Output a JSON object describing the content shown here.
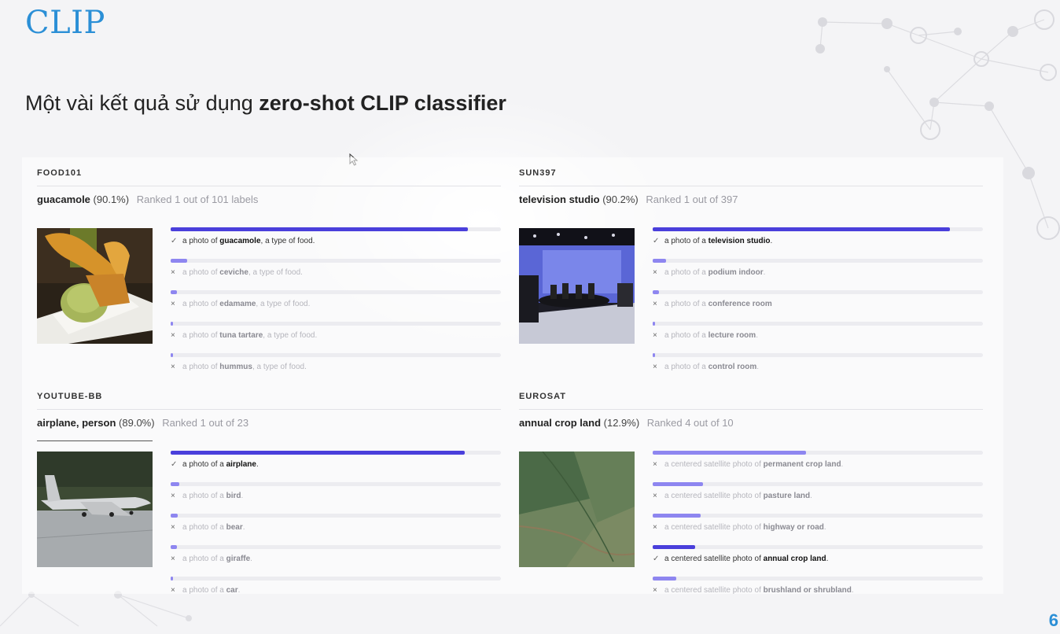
{
  "slide": {
    "title": "CLIP",
    "subtitle_prefix": "Một vài kết quả sử dụng ",
    "subtitle_bold": "zero-shot CLIP classifier",
    "page_number": "6"
  },
  "colors": {
    "accent": "#2b8fd6",
    "bar_correct": "#4a3fdb",
    "bar_other": "#8e86f0"
  },
  "cards": [
    {
      "dataset": "FOOD101",
      "label": "guacamole",
      "pct": "(90.1%)",
      "rank": "Ranked 1 out of 101 labels",
      "image": "guacamole-photo",
      "preds": [
        {
          "pre": "a photo of ",
          "key": "guacamole",
          "post": ", a type of food.",
          "value": 0.9,
          "correct": true
        },
        {
          "pre": "a photo of ",
          "key": "ceviche",
          "post": ", a type of food.",
          "value": 0.05,
          "correct": false
        },
        {
          "pre": "a photo of ",
          "key": "edamame",
          "post": ", a type of food.",
          "value": 0.02,
          "correct": false
        },
        {
          "pre": "a photo of ",
          "key": "tuna tartare",
          "post": ", a type of food.",
          "value": 0.008,
          "correct": false
        },
        {
          "pre": "a photo of ",
          "key": "hummus",
          "post": ", a type of food.",
          "value": 0.004,
          "correct": false
        }
      ]
    },
    {
      "dataset": "SUN397",
      "label": "television studio",
      "pct": "(90.2%)",
      "rank": "Ranked 1 out of 397",
      "image": "television-studio-photo",
      "preds": [
        {
          "pre": "a photo of a ",
          "key": "television studio",
          "post": ".",
          "value": 0.9,
          "correct": true
        },
        {
          "pre": "a photo of a ",
          "key": "podium indoor",
          "post": ".",
          "value": 0.04,
          "correct": false
        },
        {
          "pre": "a photo of a ",
          "key": "conference room",
          "post": "",
          "value": 0.02,
          "correct": false
        },
        {
          "pre": "a photo of a ",
          "key": "lecture room",
          "post": ".",
          "value": 0.008,
          "correct": false
        },
        {
          "pre": "a photo of a ",
          "key": "control room",
          "post": ".",
          "value": 0.005,
          "correct": false
        }
      ]
    },
    {
      "dataset": "YOUTUBE-BB",
      "label": "airplane, person",
      "pct": "(89.0%)",
      "rank": "Ranked 1 out of 23",
      "image": "airplane-photo",
      "preds": [
        {
          "pre": "a photo of a ",
          "key": "airplane",
          "post": ".",
          "value": 0.89,
          "correct": true
        },
        {
          "pre": "a photo of a ",
          "key": "bird",
          "post": ".",
          "value": 0.025,
          "correct": false
        },
        {
          "pre": "a photo of a ",
          "key": "bear",
          "post": ".",
          "value": 0.022,
          "correct": false
        },
        {
          "pre": "a photo of a ",
          "key": "giraffe",
          "post": ".",
          "value": 0.018,
          "correct": false
        },
        {
          "pre": "a photo of a ",
          "key": "car",
          "post": ".",
          "value": 0.008,
          "correct": false
        }
      ]
    },
    {
      "dataset": "EUROSAT",
      "label": "annual crop land",
      "pct": "(12.9%)",
      "rank": "Ranked 4 out of 10",
      "image": "satellite-crop-photo",
      "preds": [
        {
          "pre": "a centered satellite photo of ",
          "key": "permanent crop land",
          "post": ".",
          "value": 0.465,
          "correct": false
        },
        {
          "pre": "a centered satellite photo of ",
          "key": "pasture land",
          "post": ".",
          "value": 0.152,
          "correct": false
        },
        {
          "pre": "a centered satellite photo of ",
          "key": "highway or road",
          "post": ".",
          "value": 0.146,
          "correct": false
        },
        {
          "pre": "a centered satellite photo of ",
          "key": "annual crop land",
          "post": ".",
          "value": 0.129,
          "correct": true
        },
        {
          "pre": "a centered satellite photo of ",
          "key": "brushland or shrubland",
          "post": ".",
          "value": 0.072,
          "correct": false
        }
      ]
    }
  ]
}
